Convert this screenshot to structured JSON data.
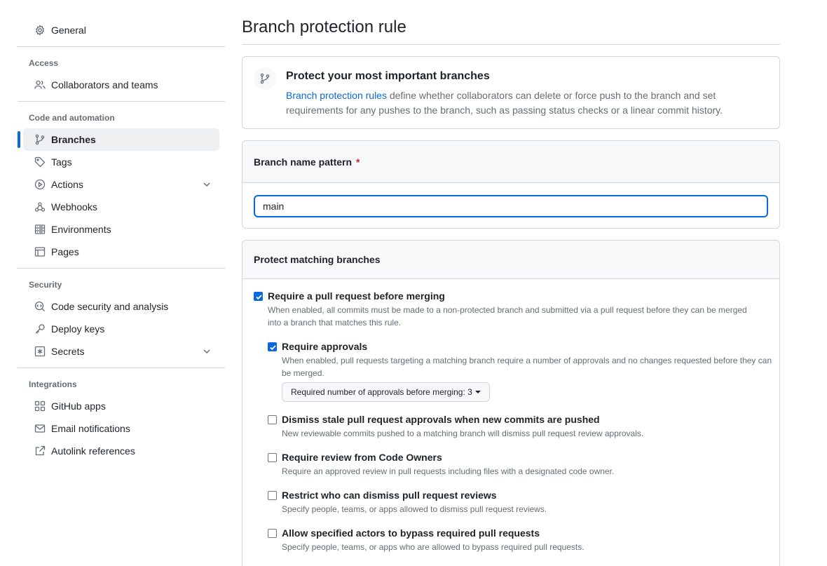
{
  "sidebar": {
    "general": "General",
    "access_heading": "Access",
    "collaborators": "Collaborators and teams",
    "code_heading": "Code and automation",
    "branches": "Branches",
    "tags": "Tags",
    "actions": "Actions",
    "webhooks": "Webhooks",
    "environments": "Environments",
    "pages": "Pages",
    "security_heading": "Security",
    "code_security": "Code security and analysis",
    "deploy_keys": "Deploy keys",
    "secrets": "Secrets",
    "integrations_heading": "Integrations",
    "github_apps": "GitHub apps",
    "email_notifications": "Email notifications",
    "autolink": "Autolink references"
  },
  "page": {
    "title": "Branch protection rule"
  },
  "intro": {
    "heading": "Protect your most important branches",
    "link_text": "Branch protection rules",
    "text": " define whether collaborators can delete or force push to the branch and set requirements for any pushes to the branch, such as passing status checks or a linear commit history."
  },
  "pattern": {
    "label": "Branch name pattern",
    "required_mark": "*",
    "value": "main"
  },
  "protect": {
    "heading": "Protect matching branches",
    "options": [
      {
        "title": "Require a pull request before merging",
        "desc": "When enabled, all commits must be made to a non-protected branch and submitted via a pull request before they can be merged into a branch that matches this rule.",
        "checked": true
      },
      {
        "title": "Require approvals",
        "desc": "When enabled, pull requests targeting a matching branch require a number of approvals and no changes requested before they can be merged.",
        "checked": true
      },
      {
        "title": "Dismiss stale pull request approvals when new commits are pushed",
        "desc": "New reviewable commits pushed to a matching branch will dismiss pull request review approvals.",
        "checked": false
      },
      {
        "title": "Require review from Code Owners",
        "desc": "Require an approved review in pull requests including files with a designated code owner.",
        "checked": false
      },
      {
        "title": "Restrict who can dismiss pull request reviews",
        "desc": "Specify people, teams, or apps allowed to dismiss pull request reviews.",
        "checked": false
      },
      {
        "title": "Allow specified actors to bypass required pull requests",
        "desc": "Specify people, teams, or apps who are allowed to bypass required pull requests.",
        "checked": false
      }
    ],
    "approvals_dropdown": "Required number of approvals before merging: 3"
  },
  "colors": {
    "accent": "#0969da",
    "required": "#cf222e",
    "muted": "#656d76",
    "border": "#d0d7de"
  }
}
